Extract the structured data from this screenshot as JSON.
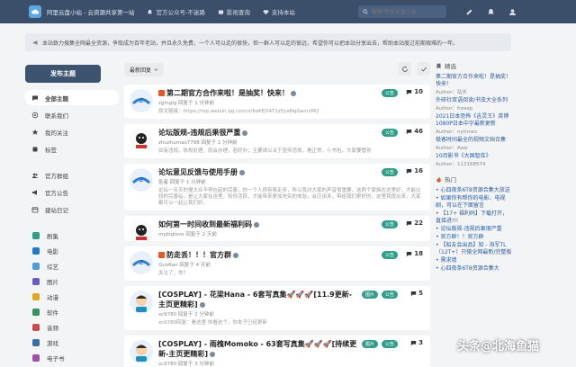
{
  "topbar": {
    "site_title": "阿里云盘小站 - 云资源共享第一站",
    "nav": [
      {
        "label": "官方公众号-不迷路",
        "icon": "bell-icon"
      },
      {
        "label": "影视查询",
        "icon": "film-icon"
      },
      {
        "label": "支持本站",
        "icon": "heart-icon"
      }
    ],
    "search_placeholder": "搜索 阿里云盘小站",
    "icons": [
      "edit-icon",
      "bell-icon",
      "user-icon"
    ]
  },
  "notice": {
    "text": "本站致力搜集全网最全资源，争取成为百年老站，并且永久免费，一个人可以走的很快，但一群人可以走的很远，希望你可以把本站分享出去，帮助本站度过前期艰难的一年。"
  },
  "sidebar": {
    "post_button": "发布主题",
    "items": [
      {
        "label": "全部主题",
        "icon": "chat-icon",
        "active": true
      },
      {
        "label": "联系我们",
        "icon": "at-icon",
        "active": false
      },
      {
        "label": "我的关注",
        "icon": "star-icon",
        "active": false
      },
      {
        "label": "标签",
        "icon": "tag-icon",
        "active": false
      }
    ],
    "items2": [
      {
        "label": "官方群组",
        "icon": "group-icon"
      },
      {
        "label": "官方公告",
        "icon": "megaphone-icon"
      },
      {
        "label": "建站日记",
        "icon": "calendar-icon"
      }
    ],
    "categories": [
      {
        "label": "剧集",
        "color": "#2f9d8a"
      },
      {
        "label": "电影",
        "color": "#1f78c8"
      },
      {
        "label": "综艺",
        "color": "#4c9fd6"
      },
      {
        "label": "图片",
        "color": "#6b5bc4"
      },
      {
        "label": "动漫",
        "color": "#e0a81f"
      },
      {
        "label": "软件",
        "color": "#3a8f63"
      },
      {
        "label": "音频",
        "color": "#cc4a4a"
      },
      {
        "label": "游戏",
        "color": "#3a6ea5"
      },
      {
        "label": "电子书",
        "color": "#a34dab"
      }
    ]
  },
  "toolbar": {
    "sort_label": "最新回复"
  },
  "posts": [
    {
      "title": "第二期官方合作来啦！是抽奖！快来！",
      "meta": "zgmglg 回复于 1 分钟前",
      "excerpt": "原文链接：https://mp.weixin.qq.com/s/6eKED4T1z5yaNqGemsMQ",
      "badges": [
        "公告"
      ],
      "replies": "10",
      "sticky": true,
      "avatar": "blue"
    },
    {
      "title": "论坛版规-违规后果很严重",
      "meta": "zhuzhumao7788 回复于 1 分钟前",
      "excerpt": "如有违规，依规处理，就会办理，若好办；主要请以关于宣传违规，看正常，小书包，大家要管你",
      "badges": [
        "公告"
      ],
      "replies": "46",
      "sticky": false,
      "avatar": "art"
    },
    {
      "title": "论坛意见反馈与使用手册",
      "meta": "贴者 回复于 1 分钟前",
      "excerpt": "论坛一天天的慢大众不停在起的完善，你一个人很容易走多，所以我对大家的声音很重要，这两个家族在这里好，才能比较的完善站。是让大家在这里，和你活跃，才能带来更加充实的体验，会应该来，带给我们更好的，这里我提出来，大家都可以一起让我们好。",
      "badges": [
        "公告"
      ],
      "replies": "16",
      "sticky": false,
      "avatar": "blue"
    },
    {
      "title": "如何第一时间收到最新福利码",
      "meta": "mybiglove 回复于 2 天前",
      "excerpt": "",
      "badges": [
        "公告"
      ],
      "replies": "22",
      "sticky": false,
      "avatar": "art"
    },
    {
      "title": "防走丢！！！官方群",
      "meta": "GuoRan 回复于 4 天前",
      "excerpt": "关注了，你？",
      "badges": [
        "公告"
      ],
      "replies": "18",
      "sticky": true,
      "avatar": "blue"
    },
    {
      "title": "[COSPLAY] - 花梁Hana - 6套写真集🚀🚀🚀[11.9更新-主页更精彩]",
      "meta": "xc9780 回复于 2 分钟前",
      "excerpt": "xc9780回复：看这里 你看这个，你本子已经更新",
      "badges": [
        "图片",
        "公告"
      ],
      "replies": "5",
      "sticky": false,
      "avatar": "cartoon"
    },
    {
      "title": "[COSPLAY] - 雨槐Momoko - 63套写真集🚀🚀🚀[持续更新-主页更精彩]",
      "meta": "xc9780 回复于 3 分钟前",
      "excerpt": "",
      "badges": [
        "图片",
        "公告"
      ],
      "replies": "3",
      "sticky": false,
      "avatar": "cartoon"
    }
  ],
  "rail": {
    "featured_title": "精选",
    "featured": [
      {
        "text": "第二期官方合作来啦！是抽奖！快来！",
        "sub": "Author：站长"
      },
      {
        "text": "外研社双语阅读/书虫大全系列",
        "sub": "Author：freesp"
      },
      {
        "text": "2021日本恐怖《吉灵王》英博1080P日本中字最新更新",
        "sub": "Author：nytimes"
      },
      {
        "text": "极客时间最全的视频文档合集",
        "sub": "Author：Azer"
      },
      {
        "text": "10月影书《大国智库》",
        "sub": "Author：113168574"
      }
    ],
    "hot_title": "热门",
    "hot": [
      "心四夜条6T8资源合集大放送",
      "如果你有帮你的电影、电视剧，可以在下面留言",
      "【17+ 福利码】下载打开，直接进!!!",
      "论坛版规-违规后果很严重",
      "官方群！！官方群",
      "【船友会出品】知 - 海军TL（12T+）只做全网最新/完整版",
      "需求墙",
      "心四夜条6T8资源合集大"
    ]
  },
  "watermark": "头条@北海鱼猫"
}
